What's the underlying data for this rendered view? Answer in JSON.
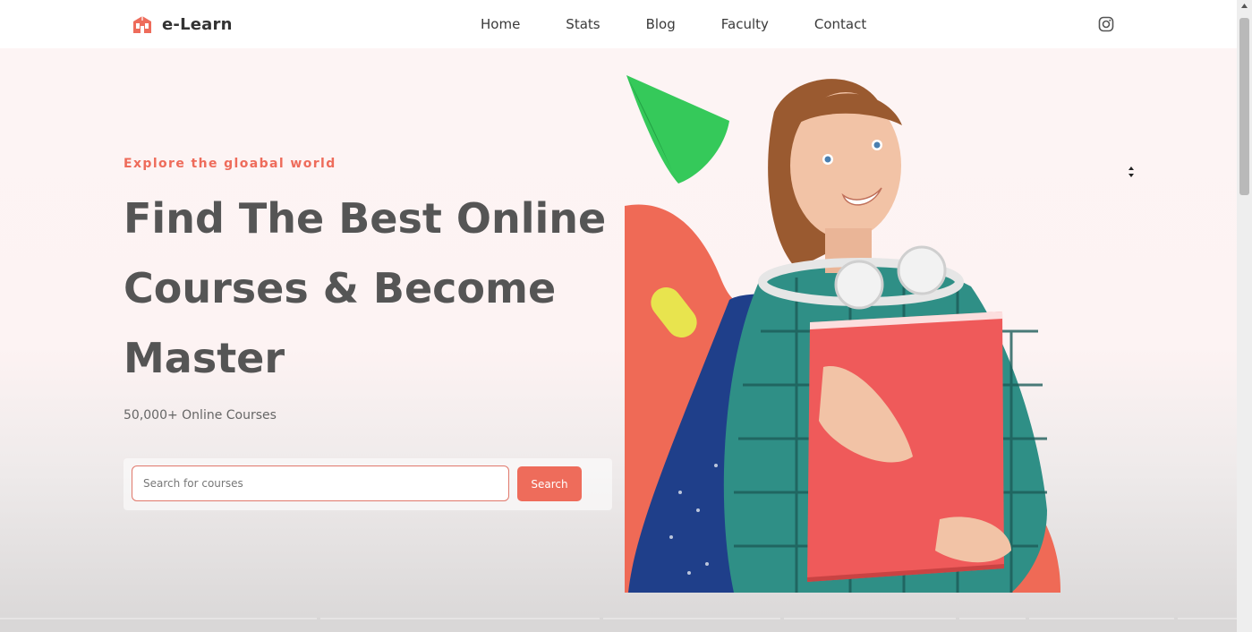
{
  "brand": {
    "name": "e-Learn",
    "logo_icon": "building-logo-icon",
    "accent": "#ee6c5b"
  },
  "nav": {
    "links": [
      {
        "label": "Home"
      },
      {
        "label": "Stats"
      },
      {
        "label": "Blog"
      },
      {
        "label": "Faculty"
      },
      {
        "label": "Contact"
      }
    ],
    "social_icon": "instagram-icon"
  },
  "hero": {
    "eyebrow": "Explore the gloabal world",
    "headline": "Find The Best Online Courses & Become Master",
    "subtext": "50,000+ Online Courses",
    "search": {
      "placeholder": "Search for courses",
      "value": "",
      "button_label": "Search"
    },
    "image_description_icon": "student-with-book-illustration"
  },
  "colors": {
    "accent": "#ee6c5b",
    "heading": "#555555",
    "nav_text": "#3a3a3a"
  }
}
